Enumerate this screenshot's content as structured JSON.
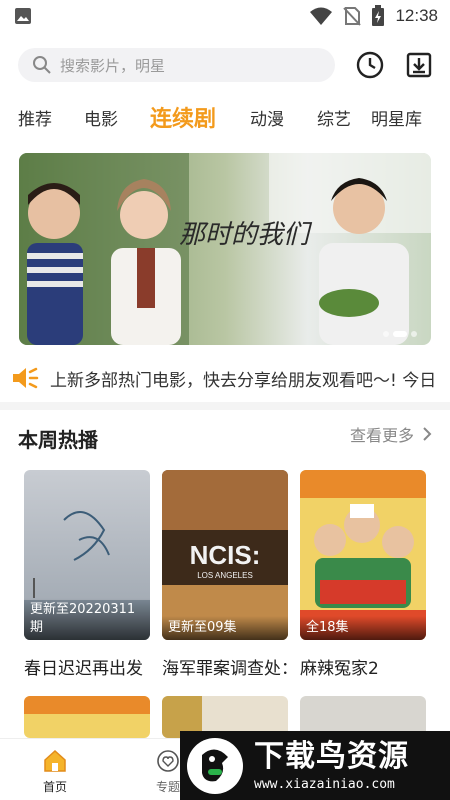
{
  "statusbar": {
    "time": "12:38"
  },
  "search": {
    "placeholder": "搜索影片，明星"
  },
  "tabs": [
    {
      "label": "推荐"
    },
    {
      "label": "电影"
    },
    {
      "label": "连续剧",
      "active": true
    },
    {
      "label": "动漫"
    },
    {
      "label": "综艺"
    },
    {
      "label": "明星库"
    }
  ],
  "banner": {
    "overlay_text": "那时的我们"
  },
  "notice": {
    "text": "上新多部热门电影，快去分享给朋友观看吧～! 今日"
  },
  "section": {
    "title": "本周热播",
    "more_label": "查看更多"
  },
  "cards": [
    {
      "title": "春日迟迟再出发",
      "badge": "更新至20220311期"
    },
    {
      "title": "海军罪案调查处：洛杉矶",
      "badge": "更新至09集"
    },
    {
      "title": "麻辣冤家2",
      "badge": "全18集"
    }
  ],
  "bottom_nav": [
    {
      "label": "首页",
      "active": true
    },
    {
      "label": "专题"
    }
  ],
  "watermark": {
    "title": "下载鸟资源",
    "url": "www.xiazainiao.com"
  },
  "colors": {
    "accent": "#f39a1c",
    "text": "#222222",
    "muted": "#9a9a9a"
  }
}
